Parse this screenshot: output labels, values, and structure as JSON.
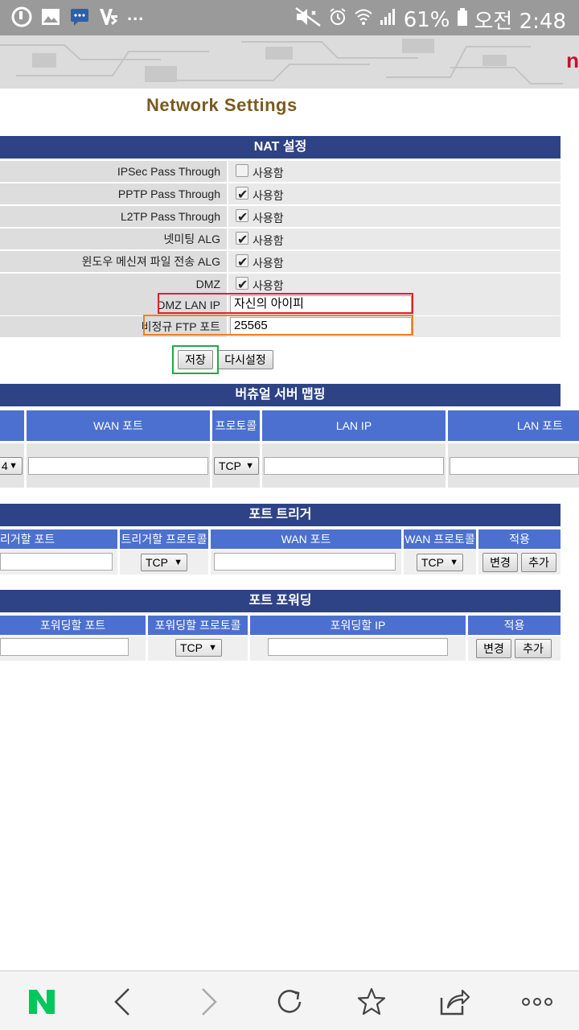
{
  "status_bar": {
    "more": "...",
    "battery": "61%",
    "time": "오전 2:48"
  },
  "banner": {
    "logo_text": "n"
  },
  "page": {
    "title": "Network Settings"
  },
  "nat": {
    "header": "NAT 설정",
    "rows": [
      {
        "label": "IPSec Pass Through",
        "checkbox_label": "사용함",
        "checked": false
      },
      {
        "label": "PPTP Pass Through",
        "checkbox_label": "사용함",
        "checked": true
      },
      {
        "label": "L2TP Pass Through",
        "checkbox_label": "사용함",
        "checked": true
      },
      {
        "label": "넷미팅 ALG",
        "checkbox_label": "사용함",
        "checked": true
      },
      {
        "label": "윈도우 메신져 파일 전송 ALG",
        "checkbox_label": "사용함",
        "checked": true
      },
      {
        "label": "DMZ",
        "checkbox_label": "사용함",
        "checked": true
      }
    ],
    "dmz_lan_ip_label": "DMZ LAN IP",
    "dmz_lan_ip_value": "자신의 아이피",
    "ftp_port_label": "비정규 FTP 포트",
    "ftp_port_value": "25565",
    "save_button": "저장",
    "reset_button": "다시설정"
  },
  "virtual_server": {
    "header": "버츄얼 서버 맵핑",
    "columns": [
      "WAN 포트",
      "프로토콜",
      "LAN IP",
      "LAN 포트"
    ],
    "partial_select": "4",
    "protocol_value": "TCP"
  },
  "port_trigger": {
    "header": "포트 트리거",
    "columns": [
      "리거할 포트",
      "트리거할 프로토콜",
      "WAN 포트",
      "WAN 프로토콜",
      "적용"
    ],
    "trigger_protocol": "TCP",
    "wan_protocol": "TCP",
    "change_button": "변경",
    "add_button": "추가"
  },
  "port_forwarding": {
    "header": "포트 포워딩",
    "columns": [
      "포워딩할 포트",
      "포워딩할 프로토콜",
      "포워딩할 IP",
      "적용"
    ],
    "protocol": "TCP",
    "change_button": "변경",
    "add_button": "추가"
  },
  "colors": {
    "section_header": "#2e4386",
    "table_header": "#4c70cf",
    "title": "#7b5a1e",
    "highlight_red": "#e0202a",
    "highlight_orange": "#f08020",
    "highlight_green": "#22a845",
    "naver_green": "#03c75a"
  },
  "bottom_nav": [
    "naver-logo",
    "back-icon",
    "forward-icon",
    "refresh-icon",
    "star-icon",
    "share-icon",
    "more-icon"
  ]
}
